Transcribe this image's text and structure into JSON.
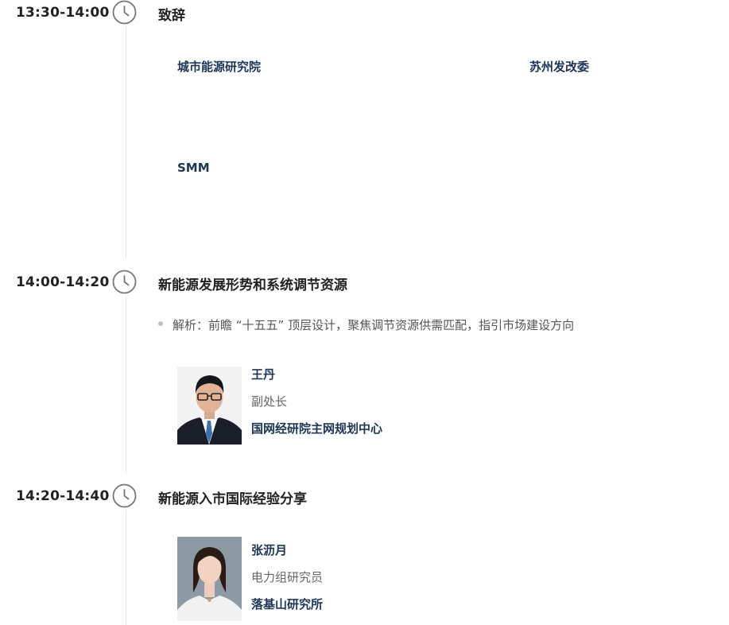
{
  "sessions": [
    {
      "time": "13:30-14:00",
      "title": "致辞",
      "orgs": [
        "城市能源研究院",
        "苏州发改委",
        "SMM"
      ]
    },
    {
      "time": "14:00-14:20",
      "title": "新能源发展形势和系统调节资源",
      "note": "解析：前瞻 “十五五” 顶层设计，聚焦调节资源供需匹配，指引市场建设方向",
      "speaker": {
        "name": "王丹",
        "role": "副处长",
        "org": "国网经研院主网规划中心"
      }
    },
    {
      "time": "14:20-14:40",
      "title": "新能源入市国际经验分享",
      "speaker": {
        "name": "张沥月",
        "role": "电力组研究员",
        "org": "落基山研究所"
      }
    }
  ],
  "icons": {
    "clock": "clock-icon"
  },
  "colors": {
    "accent": "#1d3557",
    "line": "#e3e3e3",
    "icon": "#777777"
  }
}
